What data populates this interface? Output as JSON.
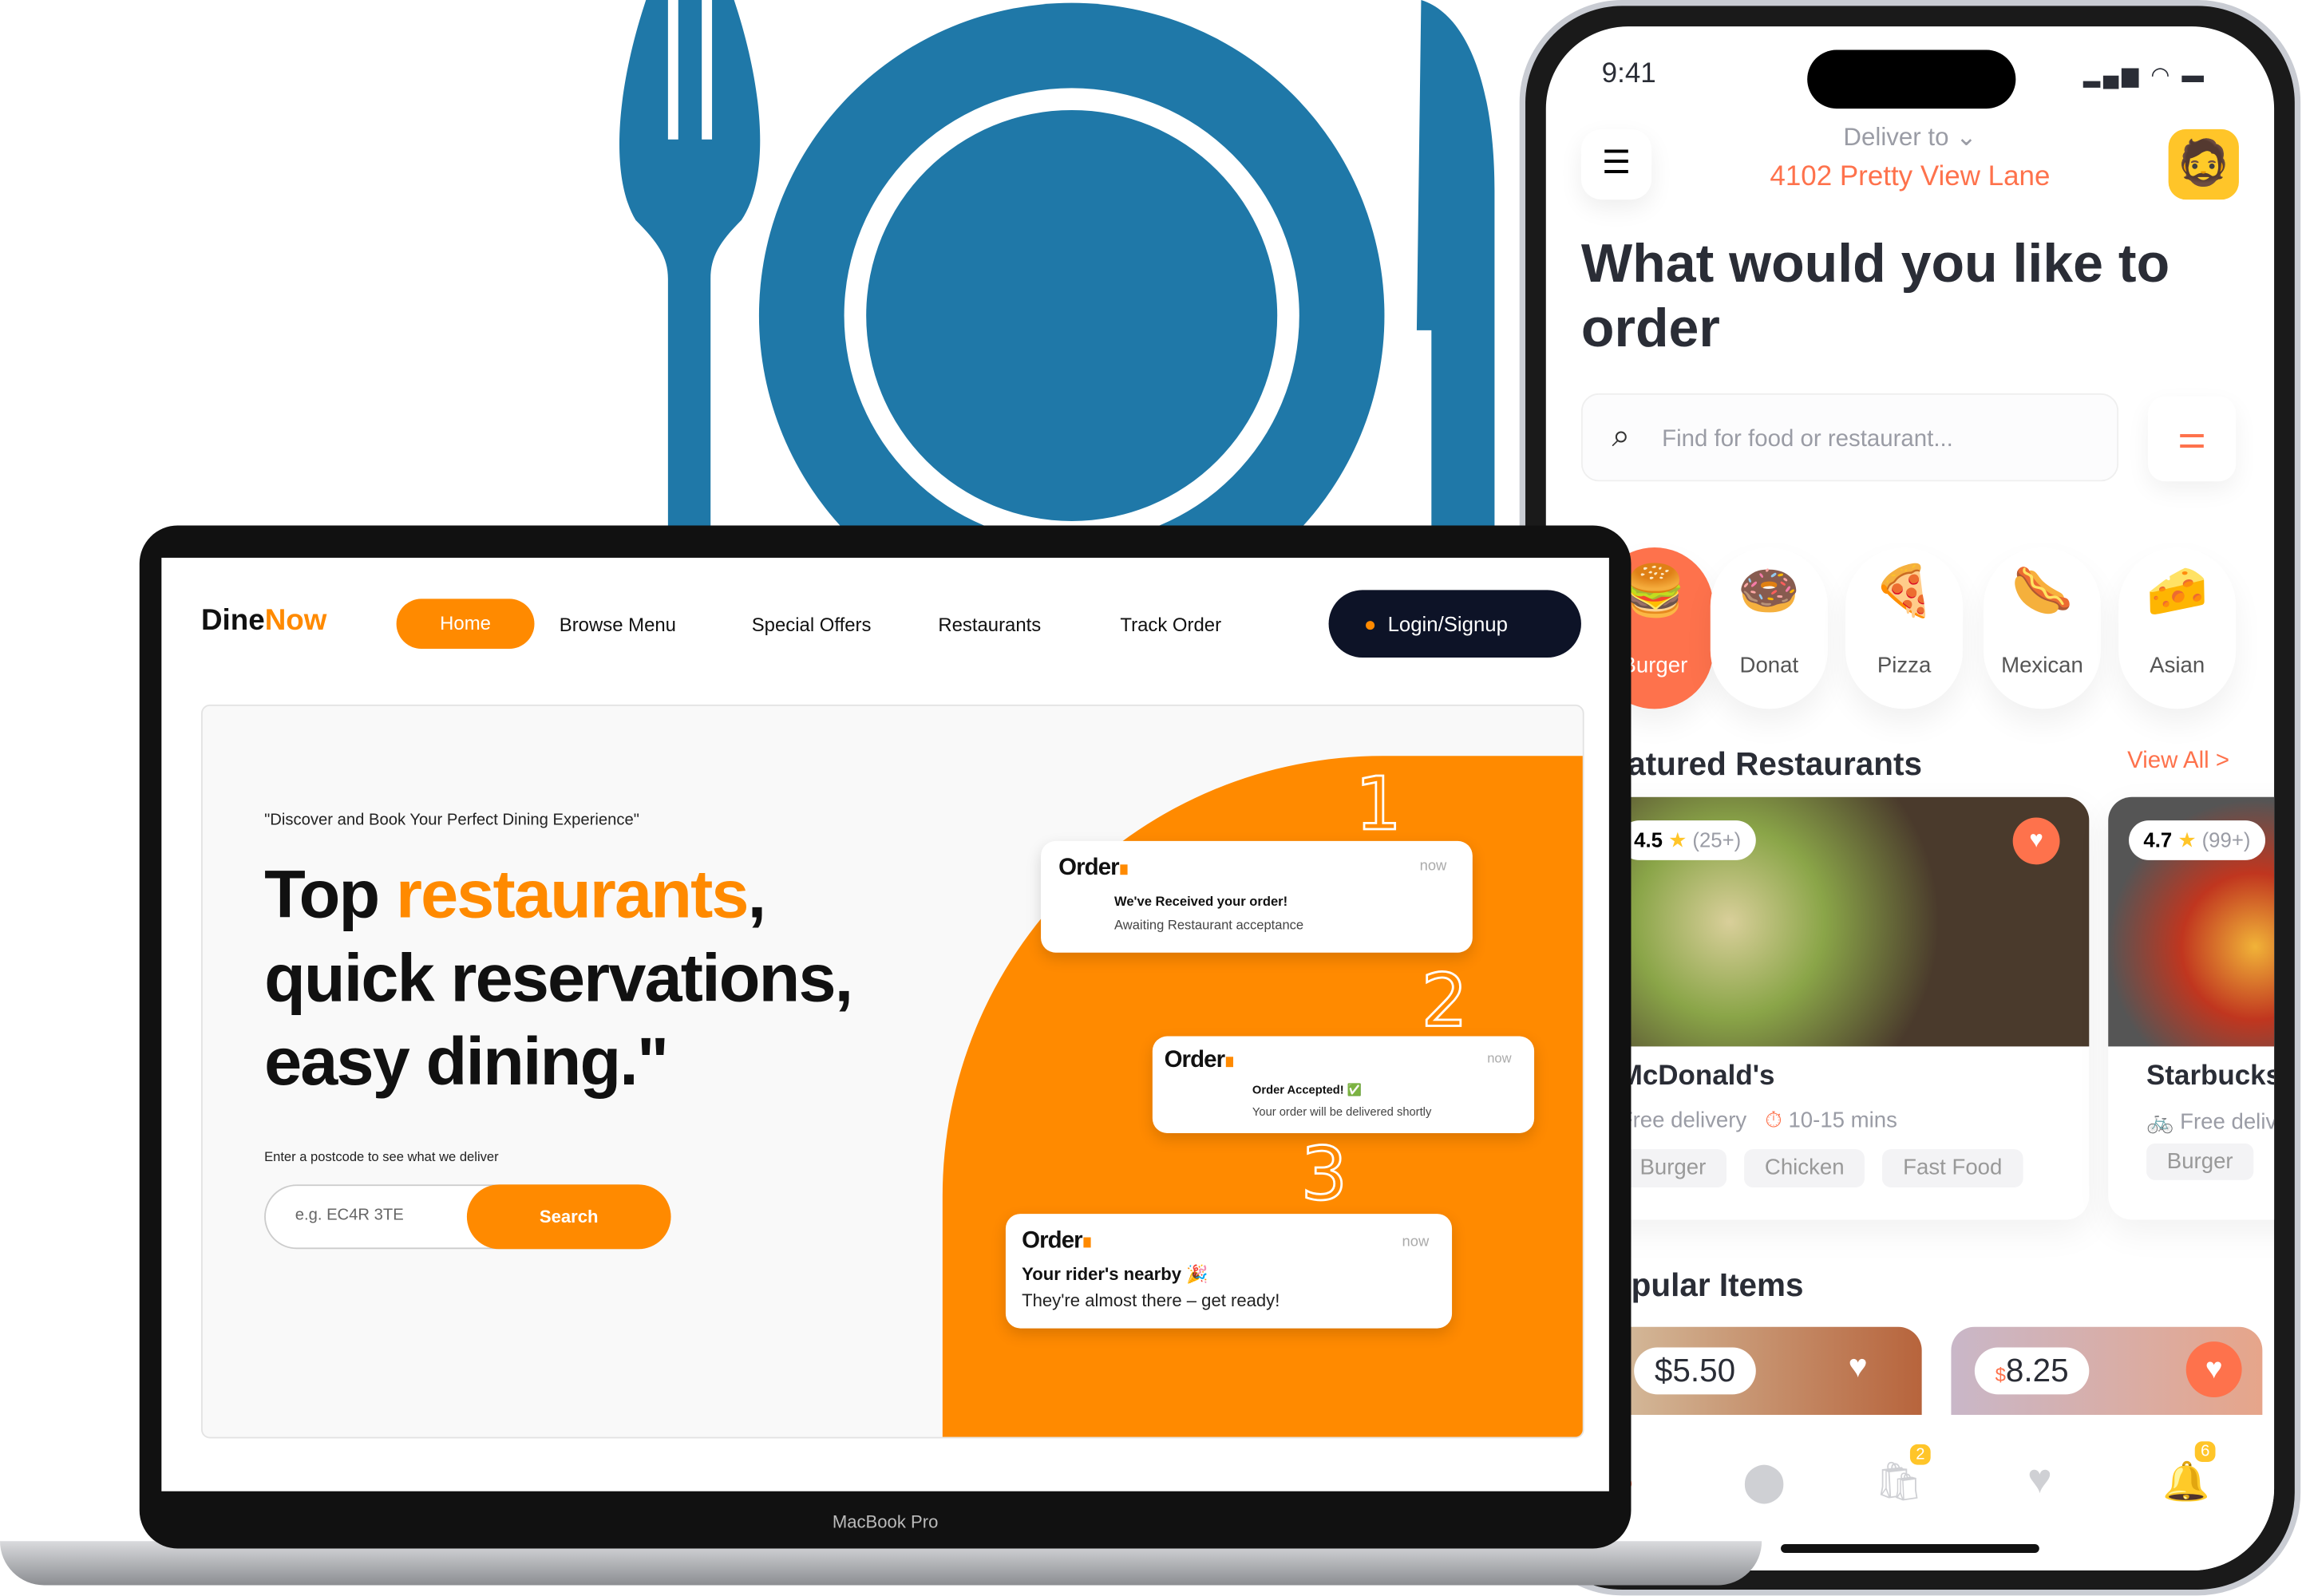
{
  "colors": {
    "brand_orange": "#FF8A00",
    "app_accent": "#FE724C",
    "plate_blue": "#1F78A8",
    "navy": "#0D1327"
  },
  "illustration": {
    "icon": "fork-plate-knife-icon"
  },
  "phone": {
    "status": {
      "time": "9:41"
    },
    "deliver_label": "Deliver to",
    "address": "4102  Pretty View Lane",
    "headline": "What would you like to order",
    "search_placeholder": "Find for food or restaurant...",
    "categories": [
      {
        "label": "Burger",
        "emoji": "🍔"
      },
      {
        "label": "Donat",
        "emoji": "🍩"
      },
      {
        "label": "Pizza",
        "emoji": "🍕"
      },
      {
        "label": "Mexican",
        "emoji": "🌭"
      },
      {
        "label": "Asian",
        "emoji": "🧀"
      }
    ],
    "featured_title": "Featured Restaurants",
    "view_all": "View All >",
    "restaurants": [
      {
        "rating": "4.5",
        "reviews": "(25+)",
        "name": "McDonald's",
        "delivery": "Free delivery",
        "time": "10-15 mins",
        "tags": [
          "Burger",
          "Chicken",
          "Fast Food"
        ]
      },
      {
        "rating": "4.7",
        "reviews": "(99+)",
        "name": "Starbucks",
        "delivery": "Free delivery",
        "tags": [
          "Burger"
        ]
      }
    ],
    "popular_title": "Popular Items",
    "popular": [
      {
        "price": "$5.50"
      },
      {
        "currency": "$",
        "price": "8.25"
      }
    ],
    "tabbar": {
      "cart_badge": "2",
      "notif_badge": "6"
    }
  },
  "laptop": {
    "model": "MacBook Pro",
    "brand_a": "Dine",
    "brand_b": "Now",
    "nav": [
      "Home",
      "Browse Menu",
      "Special Offers",
      "Restaurants",
      "Track Order"
    ],
    "login": "Login/Signup",
    "tagline": "\"Discover and Book Your Perfect Dining Experience\"",
    "hero_1": "Top ",
    "hero_2": "restaurants",
    "hero_3": ",",
    "hero_4": "quick reservations,",
    "hero_5": "easy dining.\"",
    "postcode_label": "Enter a postcode to see what we deliver",
    "postcode_placeholder": "e.g. EC4R 3TE",
    "search_button": "Search",
    "notifications": [
      {
        "step": "1",
        "brand": "Order",
        "time": "now",
        "title": "We've Received your order!",
        "body": "Awaiting Restaurant acceptance"
      },
      {
        "step": "2",
        "brand": "Order",
        "time": "now",
        "title": "Order Accepted! ✅",
        "body": "Your order will be delivered shortly"
      },
      {
        "step": "3",
        "brand": "Order",
        "time": "now",
        "title": "Your rider's nearby 🎉",
        "body": "They're almost there – get ready!"
      }
    ]
  }
}
